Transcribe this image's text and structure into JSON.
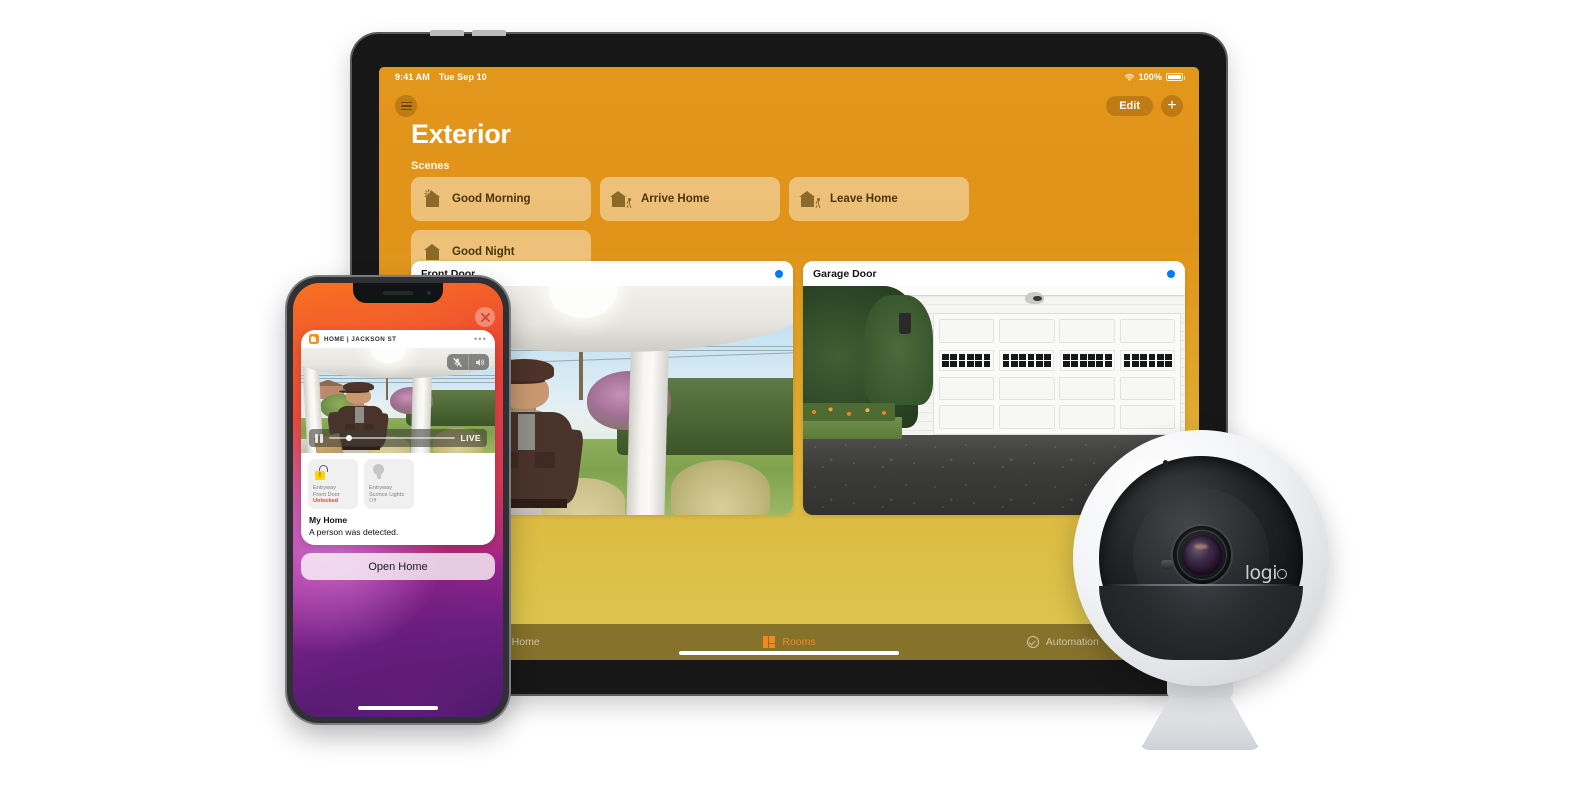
{
  "tablet": {
    "status_bar": {
      "time": "9:41 AM",
      "date": "Tue Sep 10",
      "wifi_icon": "wifi-icon",
      "battery_percent": "100%",
      "battery_icon": "battery-full-icon"
    },
    "nav": {
      "menu_icon": "sidebar-menu-icon",
      "edit_label": "Edit",
      "add_icon": "plus-icon"
    },
    "page_title": "Exterior",
    "scenes": {
      "section_label": "Scenes",
      "items": [
        {
          "label": "Good Morning",
          "icon": "sunrise-house-icon"
        },
        {
          "label": "Arrive Home",
          "icon": "house-person-arriving-icon"
        },
        {
          "label": "Leave Home",
          "icon": "house-person-leaving-icon"
        },
        {
          "label": "Good Night",
          "icon": "moon-house-icon"
        }
      ]
    },
    "cameras": [
      {
        "name": "Front Door",
        "status_icon": "blue-status-dot",
        "scene": "doorbell-delivery-person-view"
      },
      {
        "name": "Garage Door",
        "status_icon": "blue-status-dot",
        "scene": "garage-driveway-view"
      }
    ],
    "tabs": [
      {
        "label": "Home",
        "icon": "home-icon",
        "active": false
      },
      {
        "label": "Rooms",
        "icon": "rooms-grid-icon",
        "active": true
      },
      {
        "label": "Automation",
        "icon": "automation-clock-icon",
        "active": false
      }
    ]
  },
  "phone": {
    "close_icon": "close-x-icon",
    "notification": {
      "app_icon": "home-app-icon",
      "source": "HOME | JACKSON ST",
      "more_icon": "more-options-icon",
      "video": {
        "mic_icon": "microphone-muted-icon",
        "speaker_icon": "speaker-on-icon",
        "pause_icon": "pause-icon",
        "live_label": "LIVE",
        "scrubber_position_percent": 16
      },
      "accessories": [
        {
          "room": "Entryway",
          "name": "Front Door",
          "state": "Unlocked",
          "icon": "unlocked-padlock-alert-icon",
          "state_type": "alert"
        },
        {
          "room": "Entryway",
          "name": "Sconce Lights",
          "state": "Off",
          "icon": "lightbulb-icon",
          "state_type": "off"
        }
      ],
      "title": "My Home",
      "message": "A person was detected."
    },
    "open_home_button": "Open Home"
  },
  "device": {
    "camera_brand": "logi",
    "camera_name": "circle-view-camera"
  },
  "colors": {
    "accent_orange": "#f08a1c",
    "tablet_bg_top": "#e09318",
    "tablet_bg_bottom": "#dcc44c",
    "tabbar_bg": "#87722b",
    "status_dot_blue": "#007aff",
    "alert_red": "#ff3b30",
    "scene_tile_bg": "rgba(255,255,255,.42)"
  }
}
